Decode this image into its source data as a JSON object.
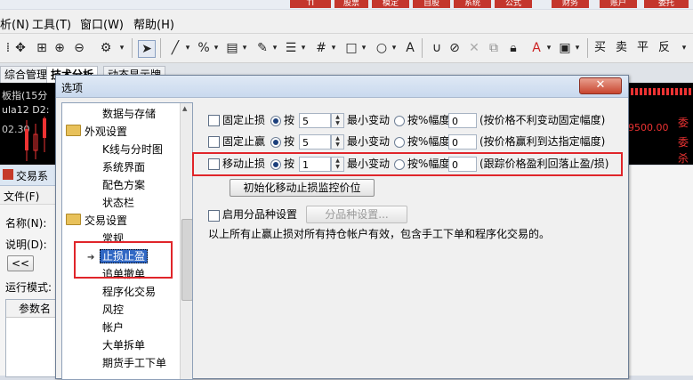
{
  "top_buttons": [
    "TI",
    "股票",
    "模定",
    "自股",
    "系统",
    "公式",
    "财务",
    "账户",
    "委托"
  ],
  "menu": {
    "items": [
      "析(N)",
      "工具(T)",
      "窗口(W)",
      "帮助(H)"
    ]
  },
  "toolbar": {
    "chars": [
      "买",
      "卖",
      "平",
      "反"
    ]
  },
  "tabs": [
    "综合管理",
    "技术分析",
    "动态显示牌"
  ],
  "chart_left": {
    "lines": [
      "板指(15分",
      "ula12 D2:",
      "02.30"
    ]
  },
  "chart_right": {
    "value": "9500.00",
    "side_labels": [
      "委",
      "委",
      "杀"
    ]
  },
  "trading_window": {
    "title": "交易系",
    "menu_file": "文件(F)",
    "name_label": "名称(N):",
    "desc_label": "说明(D):",
    "back_button": "<<",
    "run_mode_label": "运行模式:",
    "param_col": "参数名"
  },
  "dialog": {
    "title": "选项",
    "close_glyph": "✕",
    "tree": {
      "items": [
        {
          "label": "数据与存储",
          "type": "leaf"
        },
        {
          "label": "外观设置",
          "type": "folder"
        },
        {
          "label": "K线与分时图",
          "type": "leaf"
        },
        {
          "label": "系统界面",
          "type": "leaf"
        },
        {
          "label": "配色方案",
          "type": "leaf"
        },
        {
          "label": "状态栏",
          "type": "leaf"
        },
        {
          "label": "交易设置",
          "type": "folder"
        },
        {
          "label": "常规",
          "type": "leaf"
        },
        {
          "label": "止损止盈",
          "type": "selected"
        },
        {
          "label": "追单撤单",
          "type": "leaf"
        },
        {
          "label": "程序化交易",
          "type": "leaf"
        },
        {
          "label": "风控",
          "type": "leaf"
        },
        {
          "label": "帐户",
          "type": "leaf"
        },
        {
          "label": "大单拆单",
          "type": "leaf"
        },
        {
          "label": "期货手工下单",
          "type": "leaf"
        }
      ]
    },
    "rows": [
      {
        "check_label": "固定止损",
        "by": "按",
        "value": "5",
        "min_change": "最小变动",
        "by_range": "按%幅度",
        "pct": "0",
        "desc": "(按价格不利变动固定幅度)"
      },
      {
        "check_label": "固定止赢",
        "by": "按",
        "value": "5",
        "min_change": "最小变动",
        "by_range": "按%幅度",
        "pct": "0",
        "desc": "(按价格赢利到达指定幅度)"
      },
      {
        "check_label": "移动止损",
        "by": "按",
        "value": "1",
        "min_change": "最小变动",
        "by_range": "按%幅度",
        "pct": "0",
        "desc": "(跟踪价格盈利回落止盈/损)"
      }
    ],
    "init_button": "初始化移动止损监控价位",
    "variety_check": "启用分品种设置",
    "variety_button": "分品种设置...",
    "note": "以上所有止赢止损对所有持仓帐户有效，包含手工下单和程序化交易的。"
  }
}
